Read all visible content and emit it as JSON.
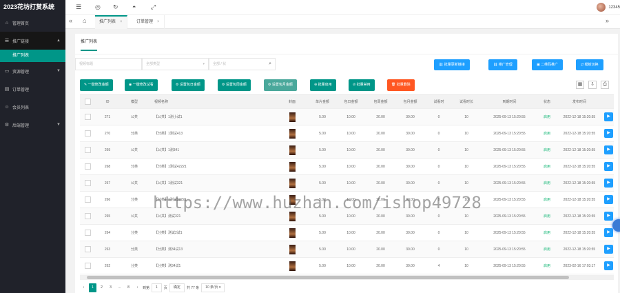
{
  "app": {
    "title": "2023花坊打赏系统"
  },
  "sidebar": {
    "items": [
      {
        "label": "管理首页",
        "icon": "home-icon"
      },
      {
        "label": "推广链接",
        "icon": "link-icon",
        "expanded": true,
        "sub": [
          {
            "label": "推广列表",
            "active": true
          }
        ]
      },
      {
        "label": "资源管理",
        "icon": "folder-icon"
      },
      {
        "label": "订单管理",
        "icon": "order-icon"
      },
      {
        "label": "会员列表",
        "icon": "user-icon"
      },
      {
        "label": "后端管理",
        "icon": "settings-icon"
      }
    ]
  },
  "topbar": {
    "user": "12345"
  },
  "tabs": [
    {
      "label": "推广列表",
      "active": true
    },
    {
      "label": "订单管理",
      "active": false
    }
  ],
  "card": {
    "title": "推广列表"
  },
  "filters": {
    "title_placeholder": "视频标题",
    "type_placeholder": "全部类型",
    "status_placeholder": "全部 / 状"
  },
  "top_buttons": [
    "批量更新链接",
    "推广管理",
    "二维码推广",
    "模板切换"
  ],
  "action_buttons": [
    {
      "label": "一键修改金额",
      "style": "normal"
    },
    {
      "label": "一键修改试看",
      "style": "normal"
    },
    {
      "label": "设置包日金额",
      "style": "normal"
    },
    {
      "label": "设置包周金额",
      "style": "normal"
    },
    {
      "label": "设置包月金额",
      "style": "light"
    },
    {
      "label": "批量启用",
      "style": "normal"
    },
    {
      "label": "批量禁用",
      "style": "normal"
    },
    {
      "label": "批量删除",
      "style": "orange"
    }
  ],
  "table": {
    "columns": [
      "",
      "ID",
      "模型",
      "视频名称",
      "封面",
      "单片金额",
      "包日金额",
      "包周金额",
      "包月金额",
      "试看时",
      "试看时长",
      "到期时间",
      "状态",
      "发布时间",
      ""
    ],
    "rows": [
      {
        "id": "271",
        "type": "公共",
        "name": "【公共】1测小试1",
        "single": "5.00",
        "day": "10.00",
        "week": "20.00",
        "month": "30.00",
        "trial": "0",
        "trial_len": "10",
        "expire": "2025-09-13 15:20:55",
        "status": "启用",
        "published": "2022-12-18 15:20:55"
      },
      {
        "id": "270",
        "type": "分类",
        "name": "【分类】1测试413",
        "single": "5.00",
        "day": "10.00",
        "week": "20.00",
        "month": "30.00",
        "trial": "0",
        "trial_len": "10",
        "expire": "2025-09-13 15:20:55",
        "status": "启用",
        "published": "2022-12-18 15:20:55"
      },
      {
        "id": "269",
        "type": "公共",
        "name": "【公共】1测341",
        "single": "5.00",
        "day": "10.00",
        "week": "20.00",
        "month": "30.00",
        "trial": "0",
        "trial_len": "10",
        "expire": "2025-09-13 15:20:55",
        "status": "启用",
        "published": "2022-12-18 15:20:55"
      },
      {
        "id": "268",
        "type": "分类",
        "name": "【分类】1测试42221",
        "single": "5.00",
        "day": "10.00",
        "week": "20.00",
        "month": "30.00",
        "trial": "0",
        "trial_len": "10",
        "expire": "2025-09-13 15:20:55",
        "status": "启用",
        "published": "2022-12-18 15:20:55"
      },
      {
        "id": "267",
        "type": "公共",
        "name": "【公共】1测试321",
        "single": "5.00",
        "day": "10.00",
        "week": "20.00",
        "month": "30.00",
        "trial": "0",
        "trial_len": "10",
        "expire": "2025-09-13 15:20:55",
        "status": "启用",
        "published": "2022-12-18 15:20:55"
      },
      {
        "id": "266",
        "type": "分类",
        "name": "【分类】1测试22221",
        "single": "5.00",
        "day": "10.00",
        "week": "20.00",
        "month": "30.00",
        "trial": "0",
        "trial_len": "10",
        "expire": "2025-09-13 15:20:55",
        "status": "启用",
        "published": "2022-12-18 15:20:55"
      },
      {
        "id": "265",
        "type": "公共",
        "name": "【公共】测试321",
        "single": "5.00",
        "day": "10.00",
        "week": "20.00",
        "month": "30.00",
        "trial": "0",
        "trial_len": "10",
        "expire": "2025-09-13 15:20:55",
        "status": "启用",
        "published": "2022-12-18 15:20:55"
      },
      {
        "id": "264",
        "type": "分类",
        "name": "【分类】测试2试1",
        "single": "5.00",
        "day": "10.00",
        "week": "20.00",
        "month": "30.00",
        "trial": "0",
        "trial_len": "10",
        "expire": "2025-09-13 15:20:55",
        "status": "启用",
        "published": "2022-12-18 15:20:55"
      },
      {
        "id": "263",
        "type": "分类",
        "name": "【分类】测34试13",
        "single": "5.00",
        "day": "10.00",
        "week": "20.00",
        "month": "30.00",
        "trial": "0",
        "trial_len": "10",
        "expire": "2025-09-13 15:20:55",
        "status": "启用",
        "published": "2022-12-18 15:20:55"
      },
      {
        "id": "262",
        "type": "分类",
        "name": "【分类】测34试1",
        "single": "5.00",
        "day": "10.00",
        "week": "20.00",
        "month": "30.00",
        "trial": "4",
        "trial_len": "10",
        "expire": "2025-09-13 15:20:55",
        "status": "启用",
        "published": "2023-02-16 17:03:17"
      }
    ]
  },
  "pager": {
    "pages": [
      "1",
      "2",
      "3",
      "...",
      "8"
    ],
    "current": "1",
    "goto_label": "到第",
    "goto_value": "1",
    "page_unit": "页",
    "confirm": "确定",
    "total": "共 77 条",
    "per_page": "10 条/页"
  },
  "watermark": "https://www.huzhan.com/ishop49728",
  "colors": {
    "sidebar": "#20222a",
    "primary": "#009688",
    "blue": "#1e9fff",
    "danger": "#ff5722"
  }
}
